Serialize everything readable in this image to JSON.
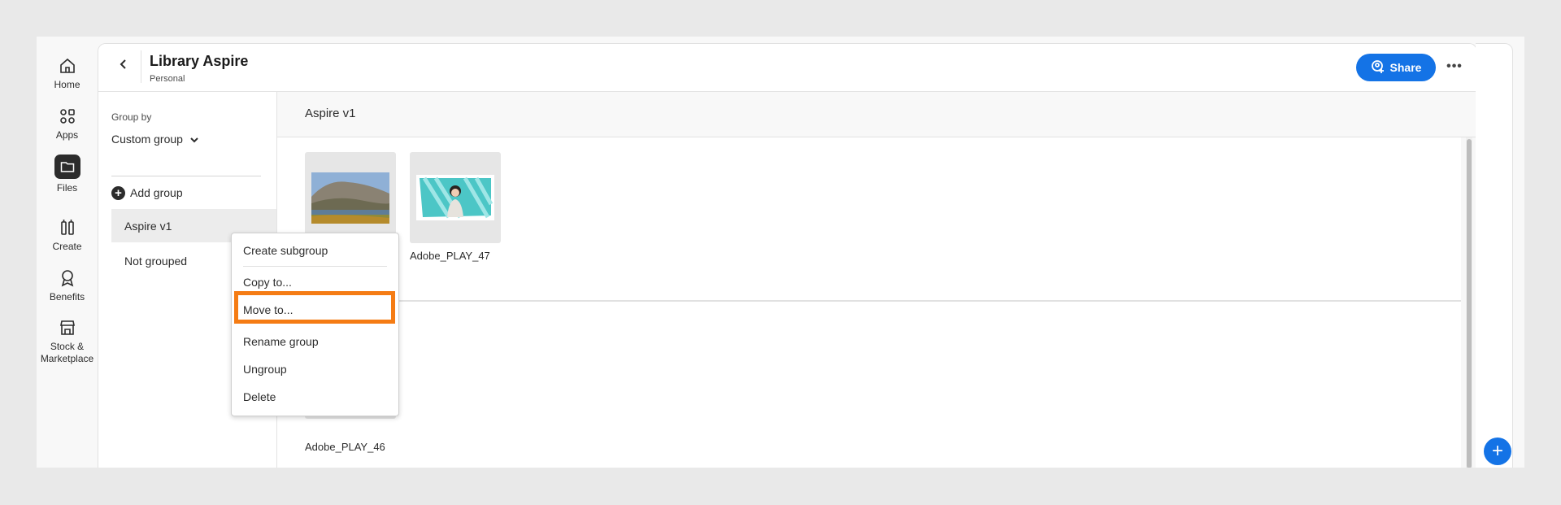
{
  "rail": {
    "items": [
      {
        "label": "Home",
        "icon": "home-icon"
      },
      {
        "label": "Apps",
        "icon": "apps-icon"
      },
      {
        "label": "Files",
        "icon": "folder-icon"
      },
      {
        "label": "Create",
        "icon": "create-icon"
      },
      {
        "label": "Benefits",
        "icon": "benefits-icon"
      },
      {
        "label_line1": "Stock &",
        "label_line2": "Marketplace",
        "icon": "store-icon"
      }
    ]
  },
  "header": {
    "title": "Library Aspire",
    "subtitle": "Personal",
    "share_label": "Share",
    "more_label": "•••"
  },
  "sidebar": {
    "group_by_label": "Group by",
    "group_by_value": "Custom group",
    "add_group_label": "Add group",
    "groups": [
      {
        "label": "Aspire v1",
        "selected": true
      },
      {
        "label": "Not grouped",
        "selected": false
      }
    ]
  },
  "main": {
    "section_title": "Aspire v1",
    "files": [
      {
        "name": "",
        "thumbnail": "landscape"
      },
      {
        "name": "Adobe_PLAY_47",
        "thumbnail": "portrait-teal"
      },
      {
        "name": "Adobe_PLAY_46",
        "thumbnail": "placeholder"
      }
    ]
  },
  "context_menu": {
    "items": [
      "Create subgroup",
      "Copy to...",
      "Move to...",
      "Rename group",
      "Ungroup",
      "Delete"
    ],
    "highlighted": "Move to..."
  },
  "fab": {
    "label": "+"
  },
  "colors": {
    "accent": "#1473e6",
    "highlight": "#f57c14",
    "background": "#e9e9e9"
  }
}
